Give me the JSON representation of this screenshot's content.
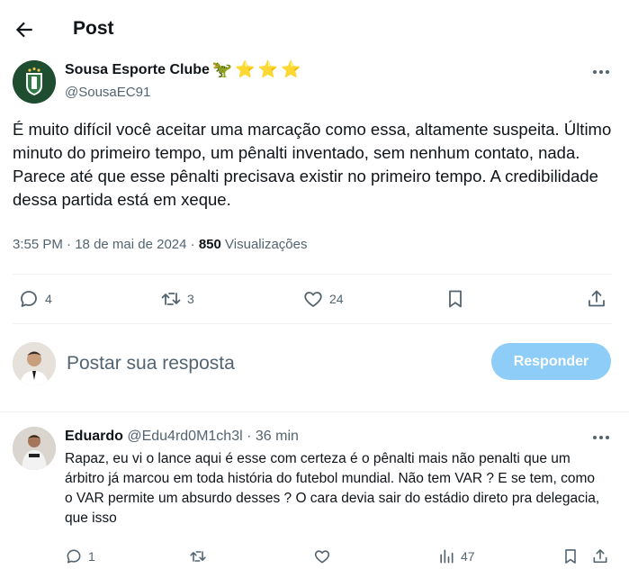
{
  "header": {
    "title": "Post",
    "back_icon": "arrow-left-icon"
  },
  "post": {
    "author_name": "Sousa Esporte Clube",
    "author_emojis": [
      "🦖",
      "⭐",
      "⭐",
      "⭐"
    ],
    "author_handle": "@SousaEC91",
    "text": "É muito difícil você aceitar uma marcação como essa, altamente suspeita. Último minuto do primeiro tempo, um pênalti inventado, sem nenhum contato, nada. Parece até que esse pênalti precisava existir no primeiro tempo. A credibilidade dessa partida está em xeque.",
    "time": "3:55 PM",
    "separator": "·",
    "date": "18 de mai de 2024",
    "views_count": "850",
    "views_label": "Visualizações",
    "replies": "4",
    "reposts": "3",
    "likes": "24"
  },
  "compose": {
    "placeholder": "Postar sua resposta",
    "button_label": "Responder",
    "button_color": "#8ecdf7"
  },
  "reply": {
    "author_name": "Eduardo",
    "author_handle": "@Edu4rd0M1ch3l",
    "separator": "·",
    "time": "36 min",
    "text": "Rapaz, eu vi o lance aqui é esse com certeza é o pênalti mais não penalti que um árbitro já marcou em toda história do futebol mundial. Não tem VAR ? E se tem, como o VAR permite um absurdo desses ? O cara devia sair do estádio direto pra delegacia, que isso",
    "replies": "1",
    "views": "47"
  },
  "colors": {
    "text": "#0f1419",
    "muted": "#536471",
    "divider": "#eff3f4",
    "club_green": "#1f4d2f"
  }
}
